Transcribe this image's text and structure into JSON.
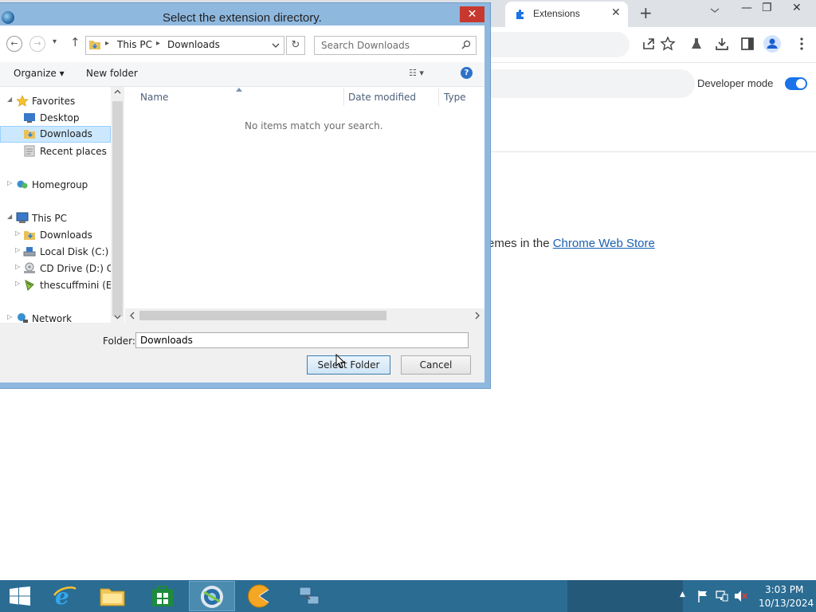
{
  "chrome": {
    "tab_title": "Extensions",
    "tab_close": "✕",
    "new_tab": "+",
    "win_min": "—",
    "win_max": "❐",
    "win_close": "✕",
    "dev_mode_label": "Developer mode",
    "store_prefix": "emes in the ",
    "store_link": "Chrome Web Store"
  },
  "dialog": {
    "title": "Select the extension directory.",
    "close_glyph": "✕",
    "nav": {
      "back": "←",
      "forward": "→",
      "recent": "▾",
      "up": "↑",
      "crumbs": [
        "This PC",
        "Downloads"
      ],
      "crumb_sep": "▸",
      "refresh": "↻",
      "search_placeholder": "Search Downloads",
      "search_glyph": "⚲"
    },
    "command_bar": {
      "organize": "Organize ▾",
      "new_folder": "New folder",
      "view": "☷ ▾",
      "help": "?"
    },
    "tree": [
      {
        "label": "Favorites",
        "tri": "◢",
        "icon": "star-icon"
      },
      {
        "label": "Desktop",
        "tri": "",
        "icon": "desktop-icon"
      },
      {
        "label": "Downloads",
        "tri": "",
        "icon": "downloads-folder-icon",
        "selected": true
      },
      {
        "label": "Recent places",
        "tri": "",
        "icon": "recent-places-icon"
      },
      {
        "label": "Homegroup",
        "tri": "▷",
        "icon": "homegroup-icon"
      },
      {
        "label": "This PC",
        "tri": "◢",
        "icon": "computer-icon"
      },
      {
        "label": "Downloads",
        "tri": "▷",
        "icon": "downloads-folder-icon"
      },
      {
        "label": "Local Disk (C:)",
        "tri": "▷",
        "icon": "local-disk-icon"
      },
      {
        "label": "CD Drive (D:) CDI",
        "tri": "▷",
        "icon": "cd-drive-icon"
      },
      {
        "label": "thescuffmini (E:)",
        "tri": "▷",
        "icon": "usb-drive-icon"
      },
      {
        "label": "Network",
        "tri": "▷",
        "icon": "network-icon"
      }
    ],
    "columns": [
      "Name",
      "Date modified",
      "Type"
    ],
    "empty_message": "No items match your search.",
    "folder_label": "Folder:",
    "folder_value": "Downloads",
    "select_button": "Select Folder",
    "cancel_button": "Cancel"
  },
  "taskbar": {
    "clock_time": "3:03 PM",
    "clock_date": "10/13/2024",
    "tray_arrow": "▲"
  }
}
